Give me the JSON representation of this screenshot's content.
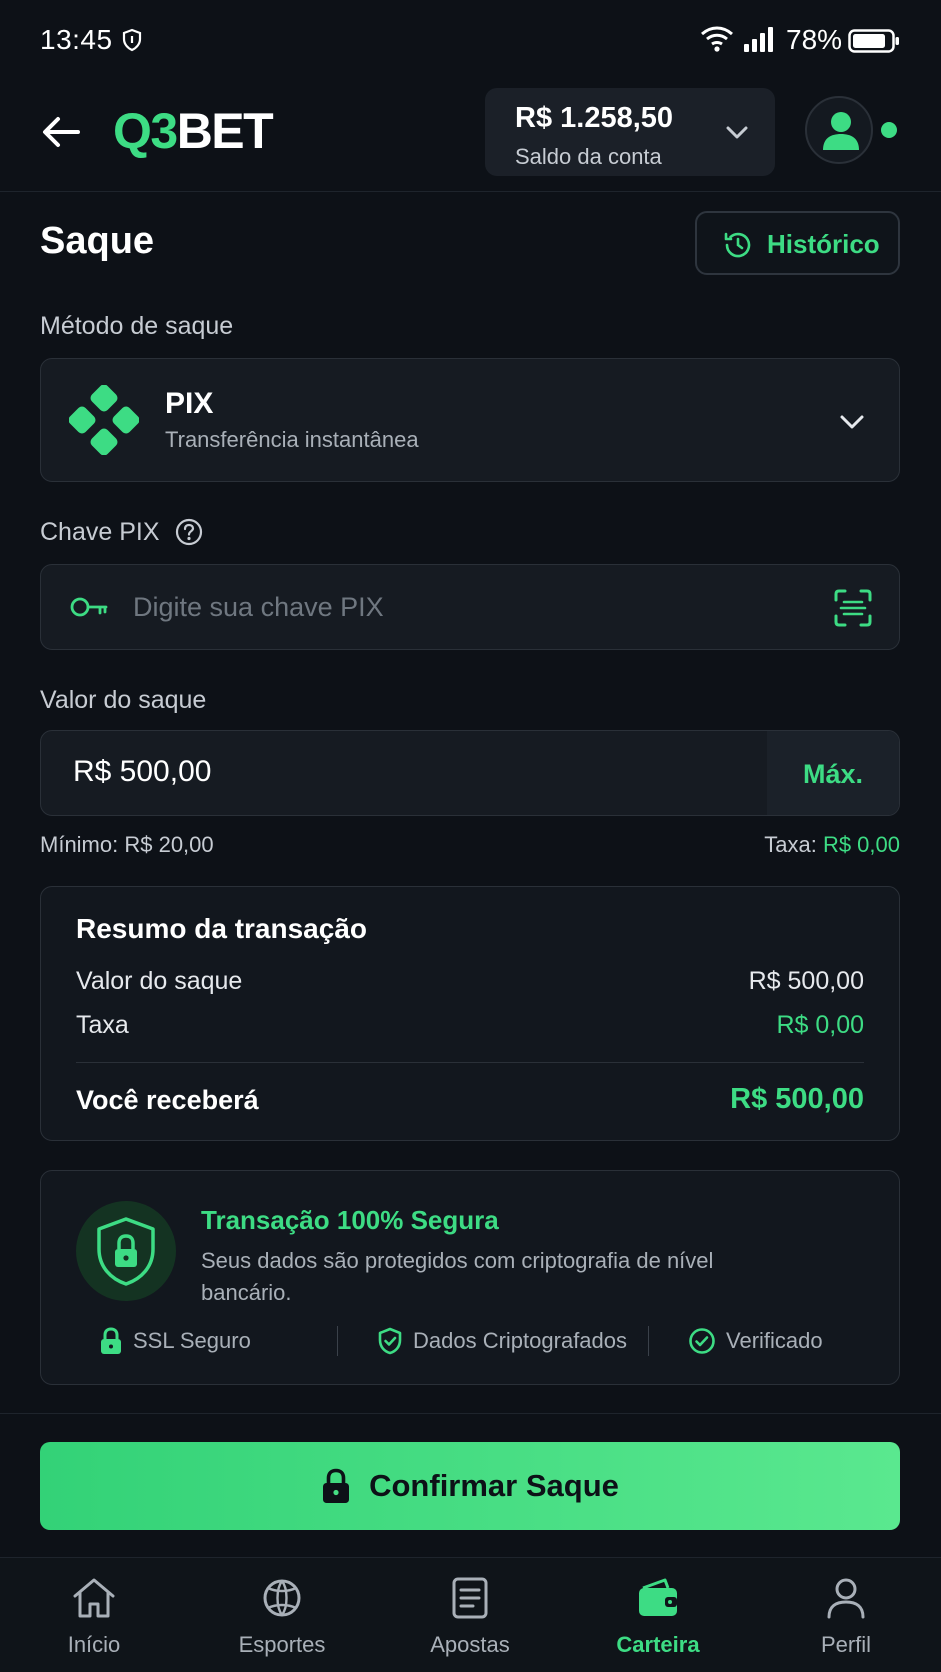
{
  "status_bar": {
    "time": "13:45",
    "battery": "78%",
    "icons": [
      "shield-icon",
      "wifi-icon",
      "signal-icon",
      "battery-icon"
    ]
  },
  "header": {
    "logo_accent": "Q3",
    "logo_text": "BET",
    "balance_amount": "R$ 1.258,50",
    "balance_label": "Saldo da conta"
  },
  "page": {
    "title": "Saque",
    "history_label": "Histórico"
  },
  "method": {
    "label": "Método de saque",
    "name": "PIX",
    "description": "Transferência instantânea"
  },
  "pix_key": {
    "label": "Chave PIX",
    "value": "",
    "placeholder": "Digite sua chave PIX"
  },
  "amount": {
    "label": "Valor do saque",
    "value": "R$ 500,00",
    "max_label": "Máx.",
    "min_text": "Mínimo: R$ 20,00",
    "fee_prefix": "Taxa:",
    "fee_value": "R$ 0,00"
  },
  "summary": {
    "title": "Resumo da transação",
    "rows": [
      {
        "label": "Valor do saque",
        "value": "R$ 500,00"
      },
      {
        "label": "Taxa",
        "value": "R$ 0,00"
      }
    ],
    "receive_label": "Você receberá",
    "receive_value": "R$ 500,00"
  },
  "security": {
    "title": "Transação 100% Segura",
    "description": "Seus dados são protegidos com criptografia de nível bancário.",
    "badges": [
      {
        "label": "SSL Seguro",
        "icon": "lock-icon"
      },
      {
        "label": "Dados Criptografados",
        "icon": "shield-check-icon"
      },
      {
        "label": "Verificado",
        "icon": "check-circle-icon"
      }
    ]
  },
  "confirm": {
    "label": "Confirmar Saque"
  },
  "nav": {
    "items": [
      {
        "label": "Início",
        "icon": "home-icon"
      },
      {
        "label": "Esportes",
        "icon": "sports-icon"
      },
      {
        "label": "Apostas",
        "icon": "bets-icon"
      },
      {
        "label": "Carteira",
        "icon": "wallet-icon",
        "active": true
      },
      {
        "label": "Perfil",
        "icon": "profile-icon"
      }
    ]
  },
  "colors": {
    "accent": "#3ddc84",
    "background": "#0d1117",
    "surface": "#161b22"
  }
}
